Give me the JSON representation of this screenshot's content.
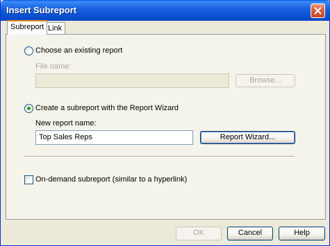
{
  "window": {
    "title": "Insert Subreport"
  },
  "tabs": [
    {
      "label": "Subreport",
      "active": true
    },
    {
      "label": "Link",
      "active": false
    }
  ],
  "existing_report": {
    "radio_label": "Choose an existing report",
    "selected": false,
    "file_name_label": "File name:",
    "file_name_value": "",
    "browse_label": "Browse...",
    "enabled": false
  },
  "wizard": {
    "radio_label": "Create a subreport with the Report Wizard",
    "selected": true,
    "new_report_name_label": "New report name:",
    "new_report_name_value": "Top Sales Reps",
    "wizard_button_label": "Report Wizard..."
  },
  "on_demand": {
    "label": "On-demand subreport (similar to a hyperlink)",
    "checked": false
  },
  "footer": {
    "ok_label": "OK",
    "cancel_label": "Cancel",
    "help_label": "Help"
  },
  "colors": {
    "titlebar": "#0a53d6",
    "dialog_background": "#ece9d8",
    "tab_active_accent": "#e68b2c",
    "radio_selected_dot": "#21a121",
    "close_button": "#d9603f"
  },
  "icons": {
    "close": "close-x-icon"
  }
}
